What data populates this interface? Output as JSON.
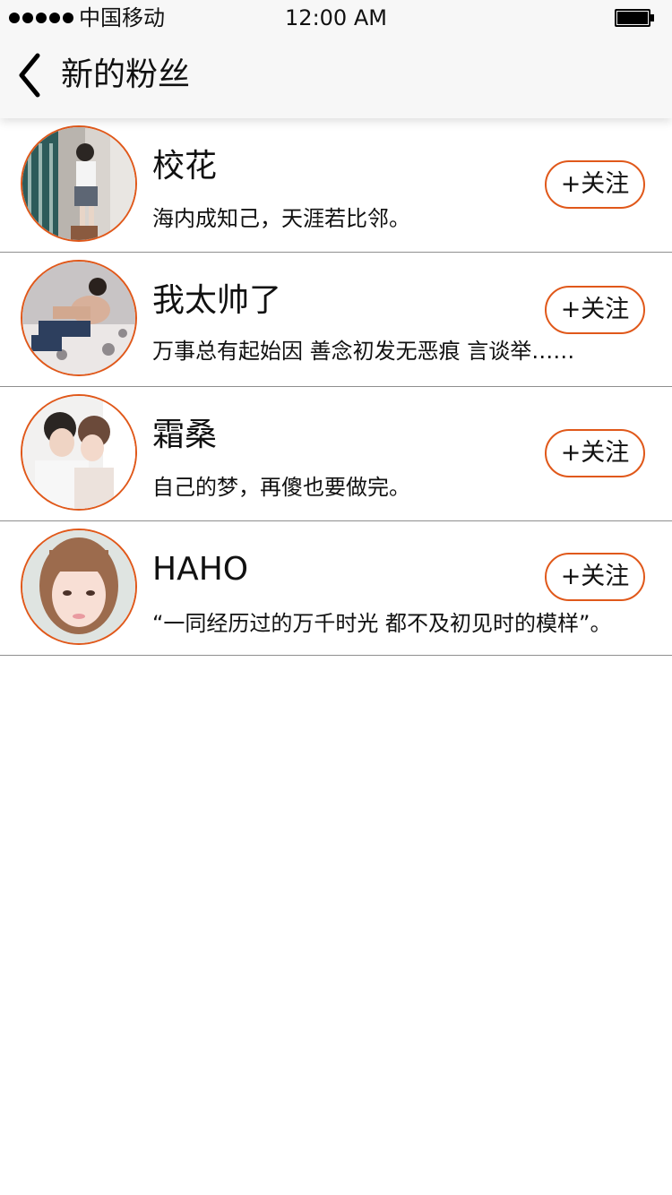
{
  "status_bar": {
    "carrier": "中国移动",
    "time": "12:00 AM"
  },
  "header": {
    "title": "新的粉丝"
  },
  "followers": [
    {
      "name": "校花",
      "bio": "海内成知己，天涯若比邻。",
      "follow_label": "+关注"
    },
    {
      "name": "我太帅了",
      "bio": "万事总有起始因 善念初发无恶痕 言谈举……",
      "follow_label": "+关注"
    },
    {
      "name": "霜桑",
      "bio": "自己的梦，再傻也要做完。",
      "follow_label": "+关注"
    },
    {
      "name": "HAHO",
      "bio": "“一同经历过的万千时光 都不及初见时的模样”。",
      "follow_label": "+关注"
    }
  ],
  "colors": {
    "accent": "#e0581a",
    "header_bg": "#f7f7f7",
    "divider": "#8f8f8f",
    "text": "#111111"
  },
  "icons": {
    "back": "chevron-left-icon",
    "signal": "signal-dots-icon",
    "battery": "battery-icon"
  }
}
